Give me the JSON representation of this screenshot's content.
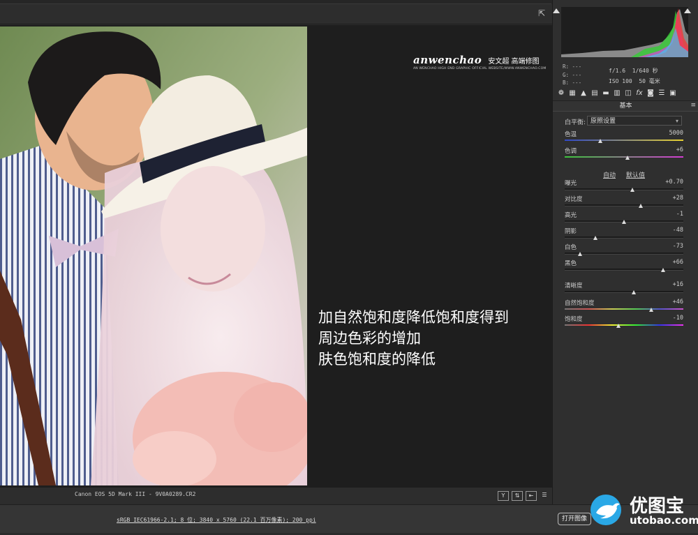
{
  "image_panel": {
    "camera": "Canon EOS 5D Mark III -  9V0A0289.CR2",
    "watermark_brand": "anwenchao",
    "watermark_cn": "安文超 高端修图",
    "watermark_sub": "AN WENCHAO HIGH END GRAPHIC OFFICIAL WEBSITE/WWW.ANWENCHAO.COM",
    "caption": [
      "加自然饱和度降低饱和度得到",
      "周边色彩的增加",
      "肤色饱和度的降低"
    ]
  },
  "bottom": {
    "workflow_info": "sRGB IEC61966-2.1; 8 位; 3840 x 5760 (22.1 百万像素); 200 ppi",
    "open_image": "打开图像"
  },
  "logo": {
    "cn": "优图宝",
    "url": "utobao.com"
  },
  "panel": {
    "rgb": {
      "r": "R: ---",
      "g": "G: ---",
      "b": "B: ---"
    },
    "aperture": "f/1.6",
    "shutter": "1/640 秒",
    "iso": "ISO 100",
    "focal": "50 毫米",
    "section_title": "基本",
    "wb_label": "白平衡:",
    "wb_value": "原照设置",
    "auto": "自动",
    "default": "默认值",
    "sliders": [
      {
        "label": "色温",
        "value": "5000",
        "pos": 0.3
      },
      {
        "label": "色调",
        "value": "+6",
        "pos": 0.53
      },
      {
        "label": "曝光",
        "value": "+0.70",
        "pos": 0.57
      },
      {
        "label": "对比度",
        "value": "+28",
        "pos": 0.64
      },
      {
        "label": "高光",
        "value": "-1",
        "pos": 0.5
      },
      {
        "label": "阴影",
        "value": "-48",
        "pos": 0.26
      },
      {
        "label": "白色",
        "value": "-73",
        "pos": 0.13
      },
      {
        "label": "黑色",
        "value": "+66",
        "pos": 0.83
      },
      {
        "label": "清晰度",
        "value": "+16",
        "pos": 0.58
      },
      {
        "label": "自然饱和度",
        "value": "+46",
        "pos": 0.73
      },
      {
        "label": "饱和度",
        "value": "-10",
        "pos": 0.45
      }
    ]
  }
}
